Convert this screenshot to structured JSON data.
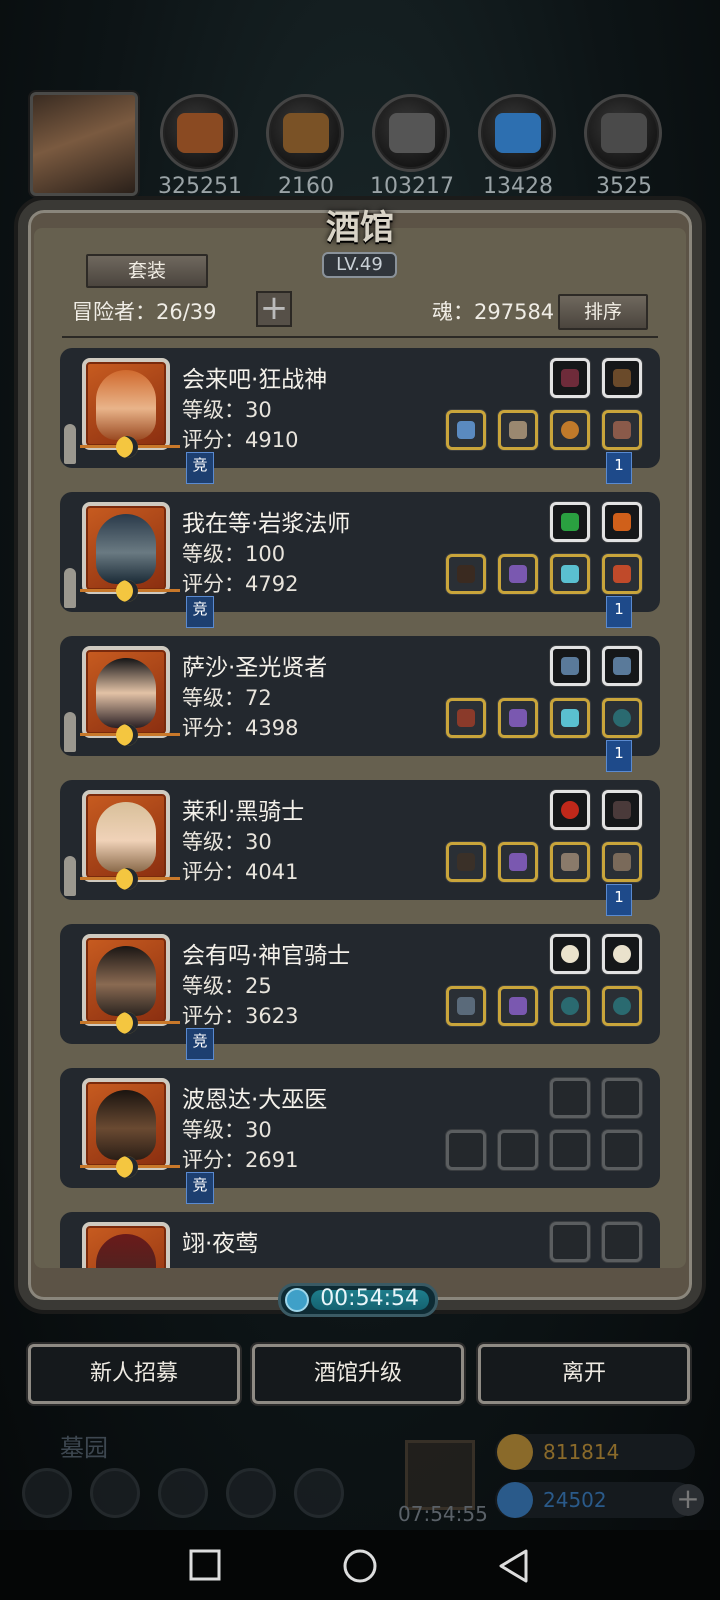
{
  "resources": [
    {
      "name": "hero-avatar"
    },
    {
      "value": "325251",
      "icon": "meat-icon",
      "color": "#8a4a22"
    },
    {
      "value": "2160",
      "icon": "wood-icon",
      "color": "#7a5226"
    },
    {
      "value": "103217",
      "icon": "stone-icon",
      "color": "#555555"
    },
    {
      "value": "13428",
      "icon": "crystal-icon",
      "color": "#2d6fb0"
    },
    {
      "value": "3525",
      "icon": "iron-icon",
      "color": "#4a4a4a"
    }
  ],
  "panel": {
    "title": "酒馆",
    "level": "LV.49",
    "set_button": "套装",
    "adventurers_label": "冒险者：26/39",
    "soul_label": "魂：297584",
    "sort_button": "排序"
  },
  "adventurers": [
    {
      "name": "会来吧·狂战神",
      "level": "等级：30",
      "score": "评分：4910",
      "badge_left": "竞",
      "badge_right": "1",
      "top_slots": [
        "accessory",
        "accessory"
      ],
      "bottom_slots": [
        "equipped",
        "equipped",
        "equipped",
        "equipped"
      ]
    },
    {
      "name": "我在等·岩浆法师",
      "level": "等级：100",
      "score": "评分：4792",
      "badge_left": "竞",
      "badge_right": "1",
      "top_slots": [
        "accessory",
        "accessory"
      ],
      "bottom_slots": [
        "equipped",
        "equipped",
        "equipped",
        "equipped"
      ]
    },
    {
      "name": "萨沙·圣光贤者",
      "level": "等级：72",
      "score": "评分：4398",
      "badge_left": "",
      "badge_right": "1",
      "top_slots": [
        "accessory",
        "accessory"
      ],
      "bottom_slots": [
        "equipped",
        "equipped",
        "equipped",
        "equipped"
      ]
    },
    {
      "name": "莱利·黑骑士",
      "level": "等级：30",
      "score": "评分：4041",
      "badge_left": "",
      "badge_right": "1",
      "top_slots": [
        "accessory",
        "accessory"
      ],
      "bottom_slots": [
        "equipped",
        "equipped",
        "equipped",
        "equipped"
      ]
    },
    {
      "name": "会有吗·神官骑士",
      "level": "等级：25",
      "score": "评分：3623",
      "badge_left": "竞",
      "badge_right": "",
      "top_slots": [
        "accessory",
        "accessory"
      ],
      "bottom_slots": [
        "equipped",
        "equipped",
        "equipped",
        "equipped"
      ]
    },
    {
      "name": "波恩达·大巫医",
      "level": "等级：30",
      "score": "评分：2691",
      "badge_left": "竞",
      "badge_right": "",
      "top_slots": [
        "empty",
        "empty"
      ],
      "bottom_slots": [
        "empty",
        "empty",
        "empty",
        "empty"
      ]
    },
    {
      "name": "翊·夜莺",
      "level": "",
      "score": "",
      "badge_left": "",
      "badge_right": "",
      "top_slots": [
        "empty",
        "empty"
      ],
      "bottom_slots": []
    }
  ],
  "timer": "00:54:54",
  "actions": {
    "recruit": "新人招募",
    "upgrade": "酒馆升级",
    "leave": "离开"
  },
  "background": {
    "location": "墓园",
    "gift_timer": "07:54:55",
    "gold": "811814",
    "gems": "24502"
  }
}
